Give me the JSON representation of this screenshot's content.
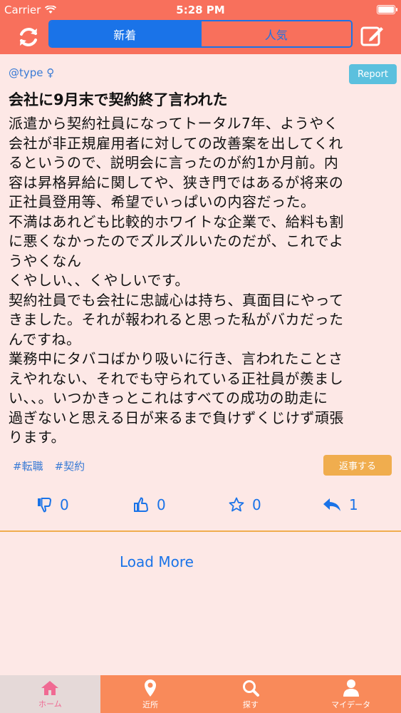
{
  "status_bar": {
    "carrier": "Carrier",
    "time": "5:28 PM"
  },
  "nav": {
    "tabs": [
      {
        "label": "新着"
      },
      {
        "label": "人気"
      }
    ]
  },
  "post": {
    "author": "@type ♀",
    "report_label": "Report",
    "title": "会社に9月末で契約終了言われた",
    "body_lines": [
      "派遣から契約社員になってトータル7年、ようやく",
      "会社が非正規雇用者に対しての改善案を出してくれ",
      "るというので、説明会に言ったのが約1か月前。内",
      "容は昇格昇給に関してや、狭き門ではあるが将来の",
      "正社員登用等、希望でいっぱいの内容だった。",
      "不満はあれども比較的ホワイトな企業で、給料も割",
      "に悪くなかったのでズルズルいたのだが、これでよ",
      "うやくなん",
      "くやしい、、くやしいです。",
      "契約社員でも会社に忠誠心は持ち、真面目にやって",
      "きました。それが報われると思った私がバカだった",
      "んですね。",
      "業務中にタバコばかり吸いに行き、言われたことさ",
      "えやれない、それでも守られている正社員が羨まし",
      "い、、。いつかきっとこれはすべての成功の助走に",
      "過ぎないと思える日が来るまで負けずくじけず頑張",
      "ります。"
    ],
    "tags": [
      "#転職",
      "#契約"
    ],
    "reply_label": "返事する",
    "counts": {
      "dislike": "0",
      "like": "0",
      "favorite": "0",
      "reply": "1"
    }
  },
  "load_more_label": "Load More",
  "tabbar": {
    "items": [
      {
        "label": "ホーム",
        "icon": "home-icon"
      },
      {
        "label": "近所",
        "icon": "location-pin-icon"
      },
      {
        "label": "探す",
        "icon": "search-icon"
      },
      {
        "label": "マイデータ",
        "icon": "user-icon"
      }
    ]
  },
  "colors": {
    "header": "#f8705c",
    "accent_blue": "#1a73e8",
    "background": "#fde8e6",
    "report": "#5bc0de",
    "reply": "#f0ad4e",
    "tabbar": "#f98a5a",
    "tab_active_text": "#f06a93"
  }
}
